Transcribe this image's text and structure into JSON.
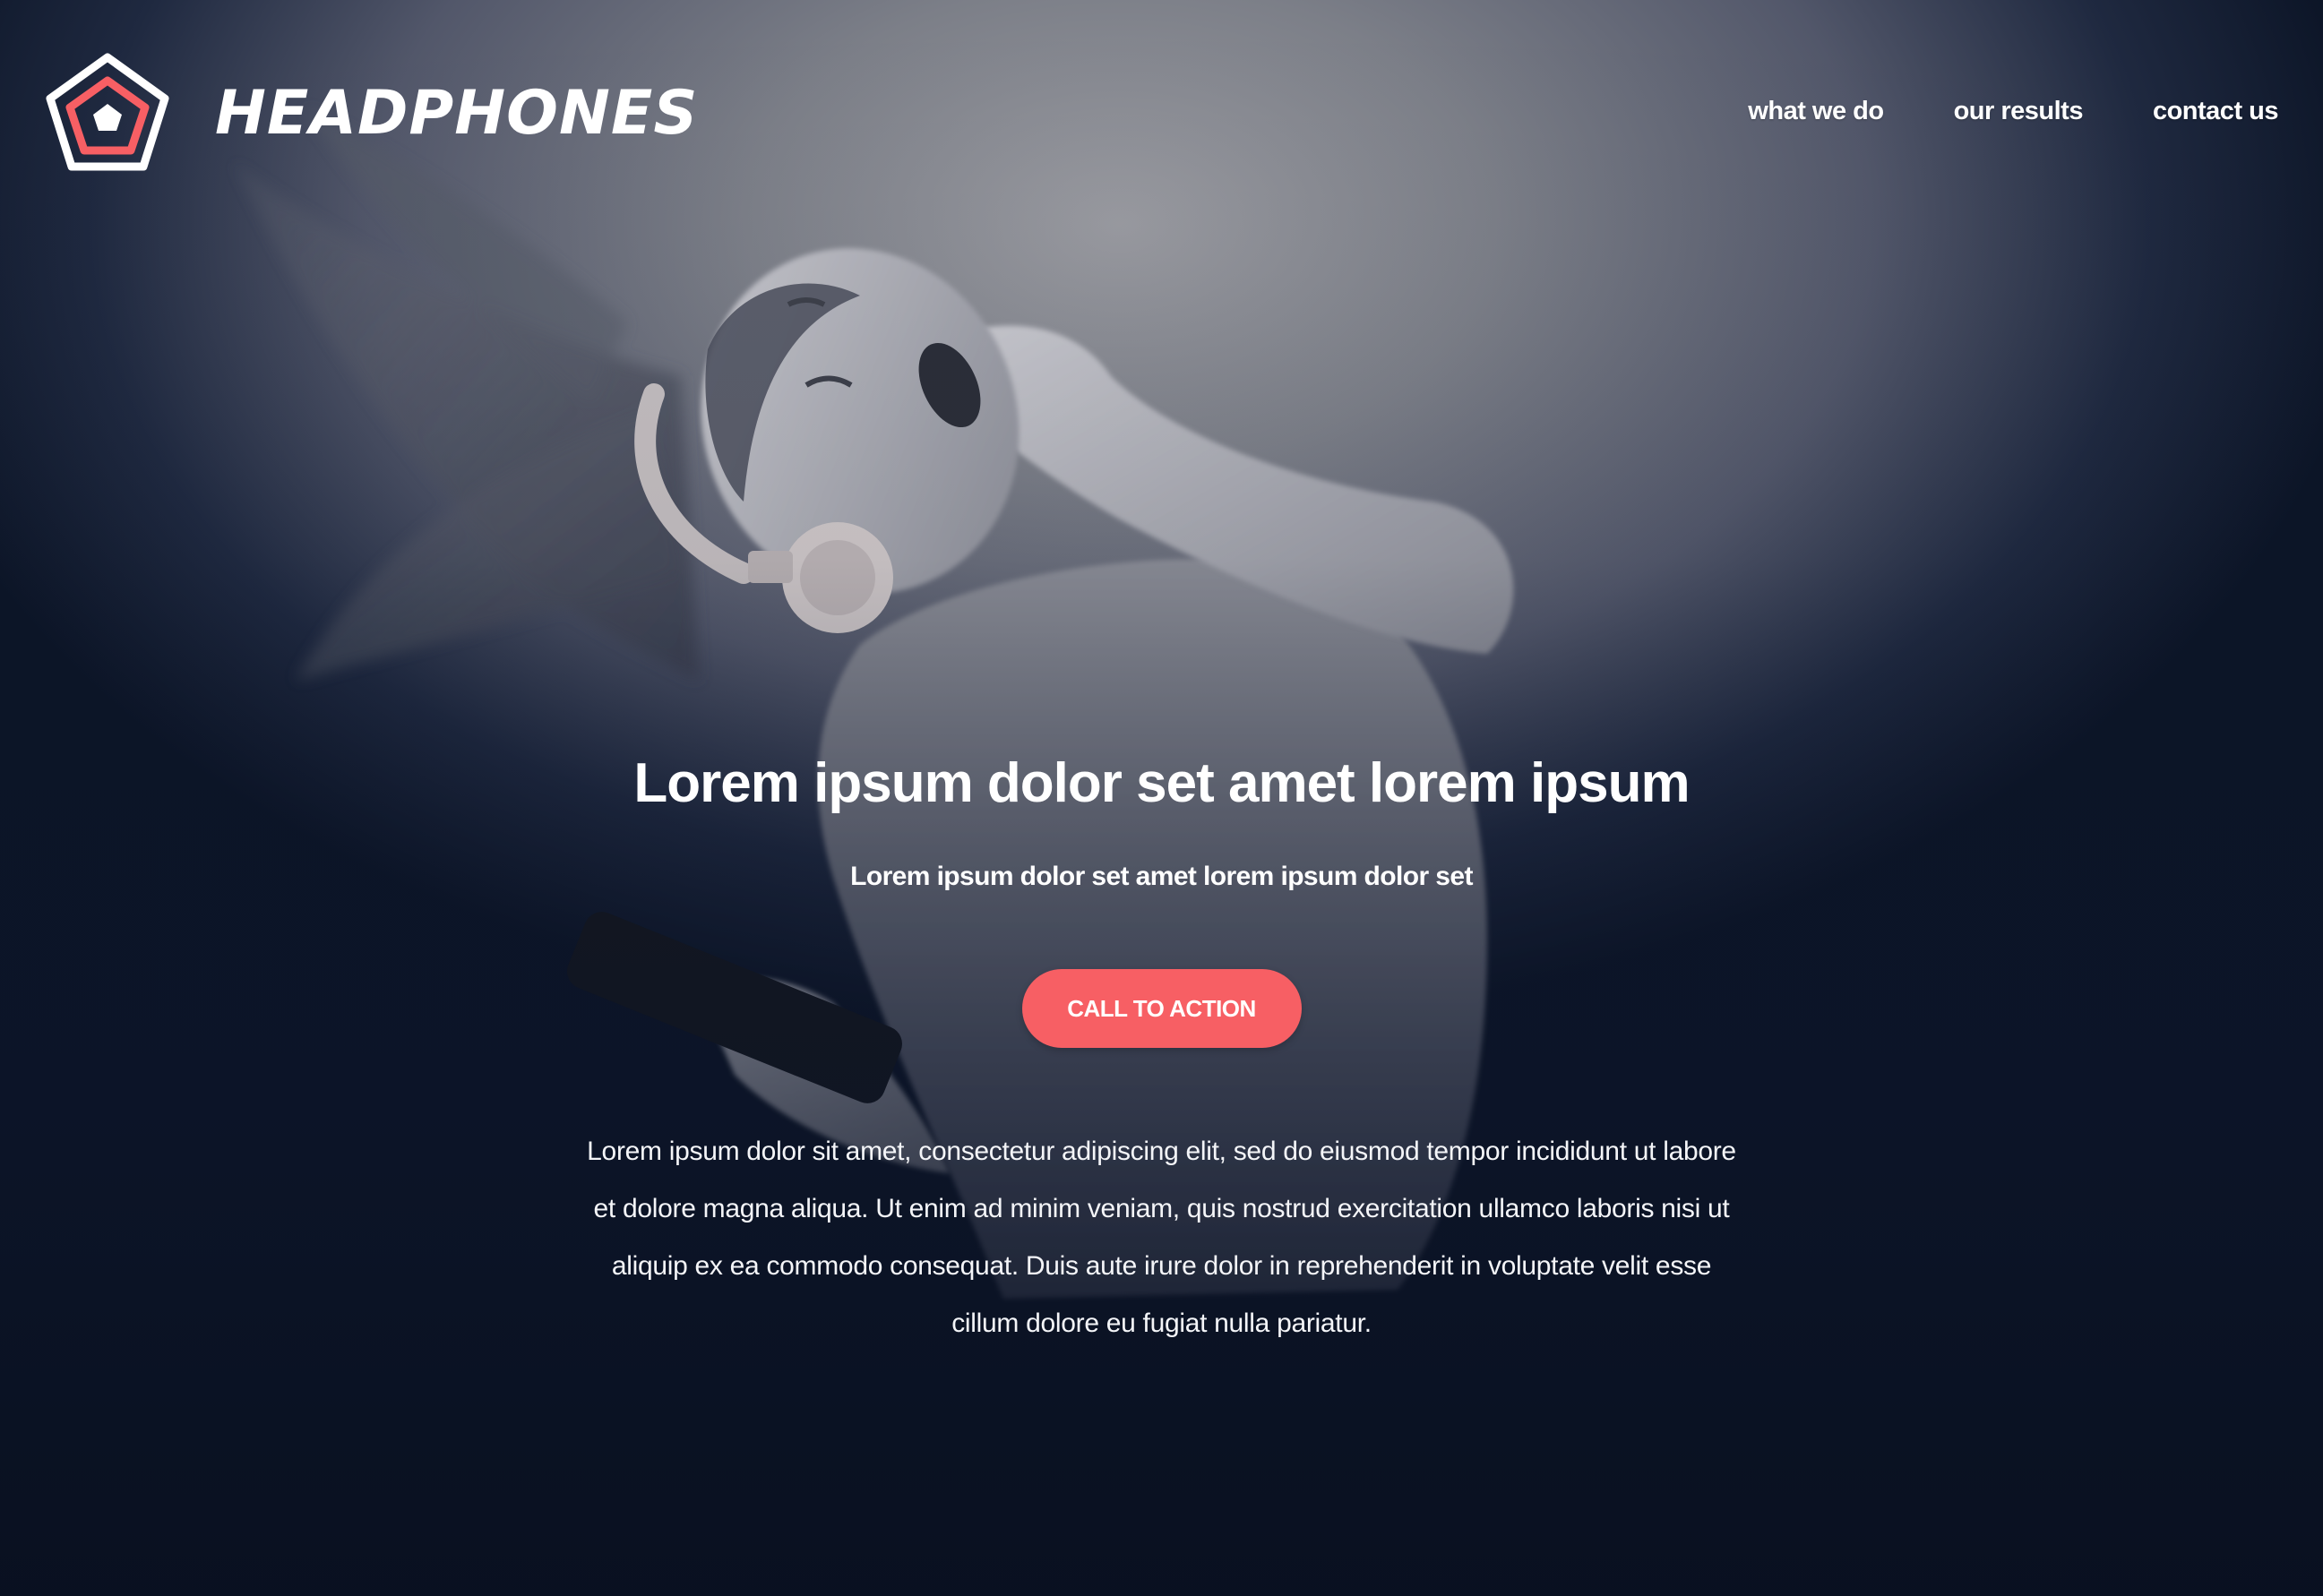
{
  "brand": {
    "name": "HEADPHONES",
    "logo_icon": "pentagon-logo-icon",
    "accent_color": "#f75f64"
  },
  "nav": {
    "items": [
      {
        "label": "what we do"
      },
      {
        "label": "our results"
      },
      {
        "label": "contact us"
      }
    ]
  },
  "hero": {
    "title": "Lorem ipsum dolor set amet lorem ipsum",
    "subtitle": "Lorem ipsum dolor set amet lorem ipsum dolor set",
    "cta_label": "CALL TO ACTION",
    "body": "Lorem ipsum dolor sit amet, consectetur adipiscing elit, sed do eiusmod tempor incididunt ut labore et dolore magna aliqua. Ut enim ad minim veniam, quis nostrud exercitation ullamco laboris nisi ut aliquip ex ea commodo consequat. Duis aute irure dolor in reprehenderit in voluptate velit esse cillum dolore eu fugiat nulla pariatur."
  }
}
